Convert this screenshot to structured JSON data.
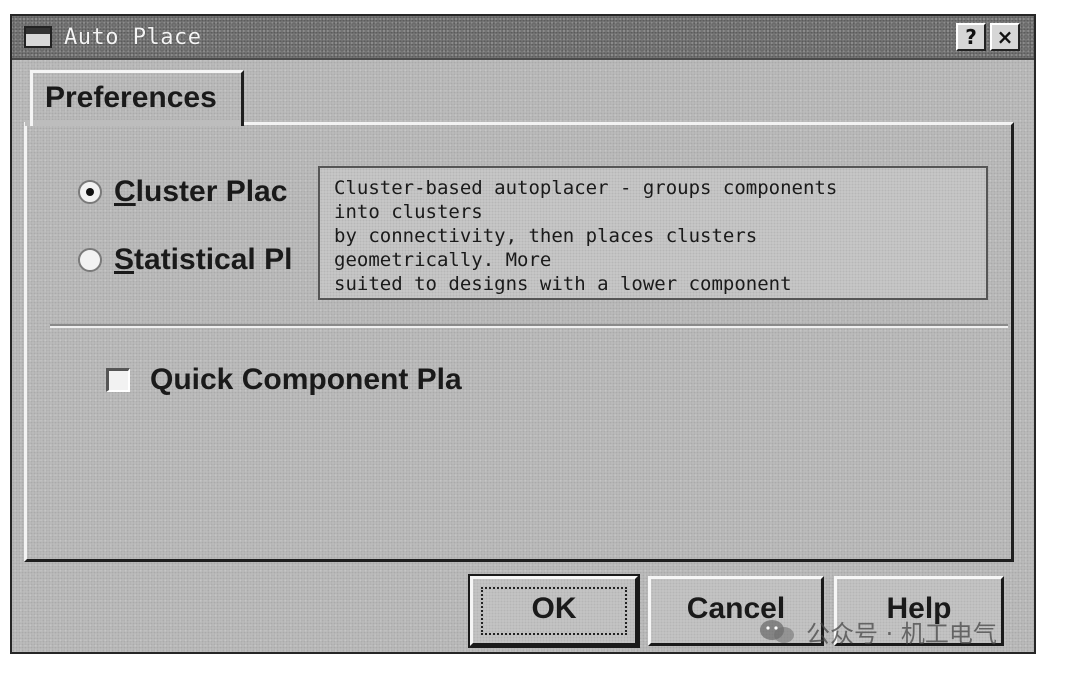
{
  "window": {
    "title": "Auto Place",
    "help_button": "?",
    "close_button": "×"
  },
  "tab": {
    "label": "Preferences"
  },
  "options": {
    "cluster": {
      "prefix": "",
      "accel": "C",
      "rest": "luster Plac",
      "checked": true
    },
    "statistical": {
      "prefix": "",
      "accel": "S",
      "rest": "tatistical Pl",
      "checked": false
    }
  },
  "tooltip": {
    "lines": [
      "Cluster-based autoplacer - groups components",
      "into clusters",
      "by connectivity, then places  clusters",
      "geometrically. More",
      "suited to designs with a lower component"
    ]
  },
  "quick_component": {
    "label": "Quick Component Pla",
    "checked": false
  },
  "buttons": {
    "ok": "OK",
    "cancel": "Cancel",
    "help": "Help"
  },
  "watermark": {
    "text": "公众号 · 机工电气"
  }
}
